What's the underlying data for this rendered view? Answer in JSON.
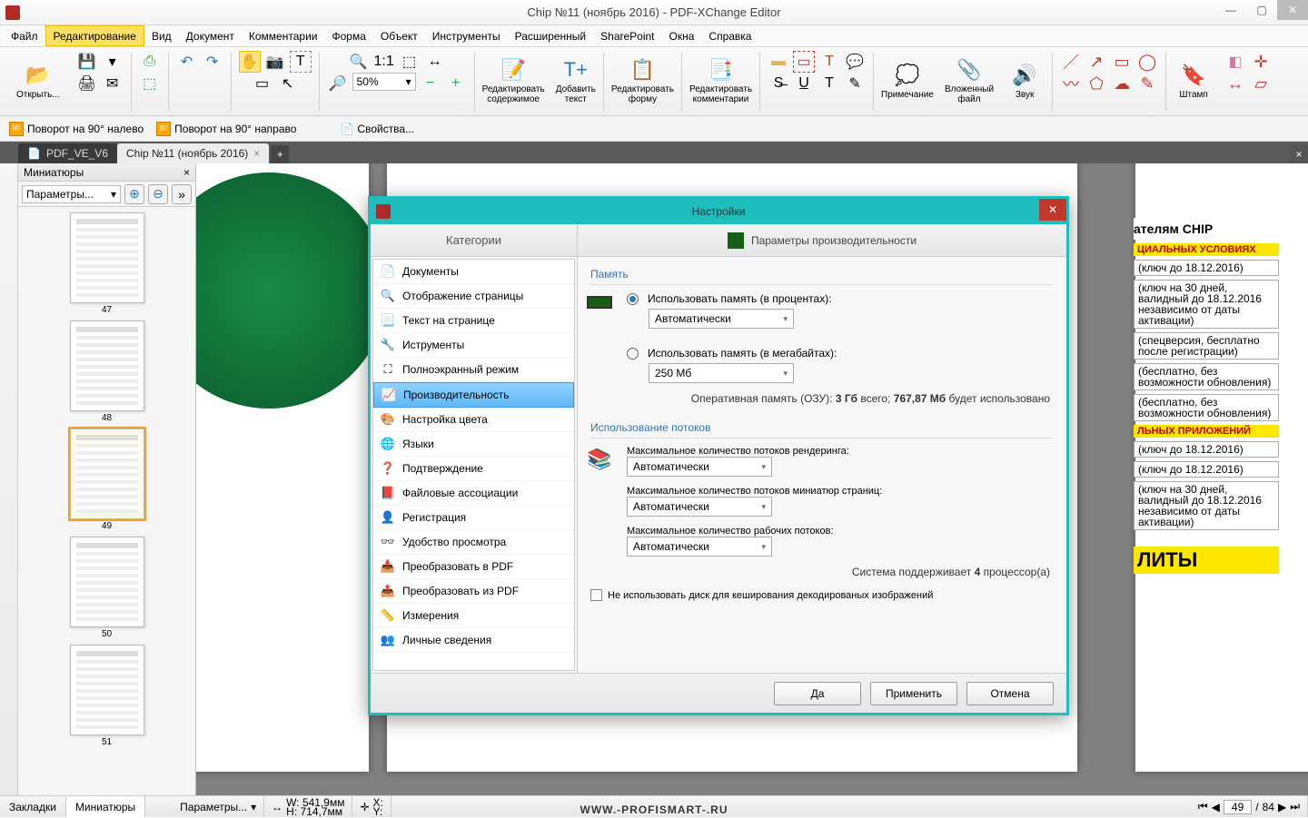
{
  "title": "Chip №11 (ноябрь 2016) - PDF-XChange Editor",
  "menu": {
    "items": [
      "Файл",
      "Редактирование",
      "Вид",
      "Документ",
      "Комментарии",
      "Форма",
      "Объект",
      "Инструменты",
      "Расширенный",
      "SharePoint",
      "Окна",
      "Справка"
    ],
    "active_index": 1
  },
  "ribbon": {
    "open": "Открыть...",
    "zoom_value": "50%",
    "edit_content": "Редактировать\nсодержимое",
    "add_text": "Добавить\nтекст",
    "edit_form": "Редактировать\nформу",
    "edit_comments": "Редактировать\nкомментарии",
    "note": "Примечание",
    "attachment": "Вложенный\nфайл",
    "sound": "Звук",
    "stamp": "Штамп"
  },
  "subbar": {
    "rotate_left": "Поворот на 90° налево",
    "rotate_right": "Поворот на 90° направо",
    "properties": "Свойства..."
  },
  "tabs": {
    "inactive": "PDF_VE_V6",
    "active": "Chip №11 (ноябрь 2016)"
  },
  "thumbnails": {
    "title": "Миниатюры",
    "options": "Параметры...",
    "pages": [
      47,
      48,
      49,
      50,
      51
    ],
    "selected": 49
  },
  "dialog": {
    "title": "Настройки",
    "cat_header": "Категории",
    "set_header": "Параметры производительности",
    "categories": [
      "Документы",
      "Отображение страницы",
      "Текст на странице",
      "Иструменты",
      "Полноэкранный режим",
      "Производительность",
      "Настройка цвета",
      "Языки",
      "Подтверждение",
      "Файловые ассоциации",
      "Регистрация",
      "Удобство просмотра",
      "Преобразовать в PDF",
      "Преобразовать из PDF",
      "Измерения",
      "Личные сведения"
    ],
    "selected_cat_index": 5,
    "memory": {
      "group": "Память",
      "opt_percent": "Использовать память (в процентах):",
      "percent_value": "Автоматически",
      "opt_mb": "Использовать память (в мегабайтах):",
      "mb_value": "250 Мб",
      "ram_label": "Оперативная память (ОЗУ): ",
      "ram_total": "3 Гб",
      "ram_mid": " всего; ",
      "ram_used": "767,87 Мб",
      "ram_tail": " будет использовано"
    },
    "threads": {
      "group": "Использование потоков",
      "render_label": "Максимальное количество потоков рендеринга:",
      "render_value": "Автоматически",
      "thumb_label": "Максимальное количество потоков миниатюр страниц:",
      "thumb_value": "Автоматически",
      "work_label": "Максимальное количество рабочих потоков:",
      "work_value": "Автоматически",
      "cpu_prefix": "Система поддерживает ",
      "cpu_count": "4",
      "cpu_suffix": " процессор(а)"
    },
    "no_disk_cache": "Не использовать диск для кеширования декодированых изображений",
    "btn_ok": "Да",
    "btn_apply": "Применить",
    "btn_cancel": "Отмена"
  },
  "rightcol": {
    "head1": "ателям CHIP",
    "lab1": "ЦИАЛЬНЫХ УСЛОВИЯХ",
    "r1": "(ключ до 18.12.2016)",
    "r2": "(ключ на 30 дней, валидный до 18.12.2016 независимо от даты активации)",
    "r3": "(спецверсия, бесплатно после регистрации)",
    "r4": "(бесплатно, без возможности обновления)",
    "r5": "(бесплатно, без возможности обновления)",
    "lab2": "ЛЬНЫХ ПРИЛОЖЕНИЙ",
    "r6": "(ключ до 18.12.2016)",
    "r7": "(ключ до 18.12.2016)",
    "r8": "(ключ на 30 дней, валидный до 18.12.2016 независимо от даты активации)",
    "head2": "ЛИТЫ"
  },
  "status": {
    "bookmarks": "Закладки",
    "thumbs": "Миниатюры",
    "options": "Параметры...",
    "w": "W: 541,9мм",
    "h": "H: 714,7мм",
    "x": "X:",
    "y": "Y:",
    "page_cur": "49",
    "page_total": "84"
  },
  "watermark": "WWW.-PROFISMART-.RU"
}
